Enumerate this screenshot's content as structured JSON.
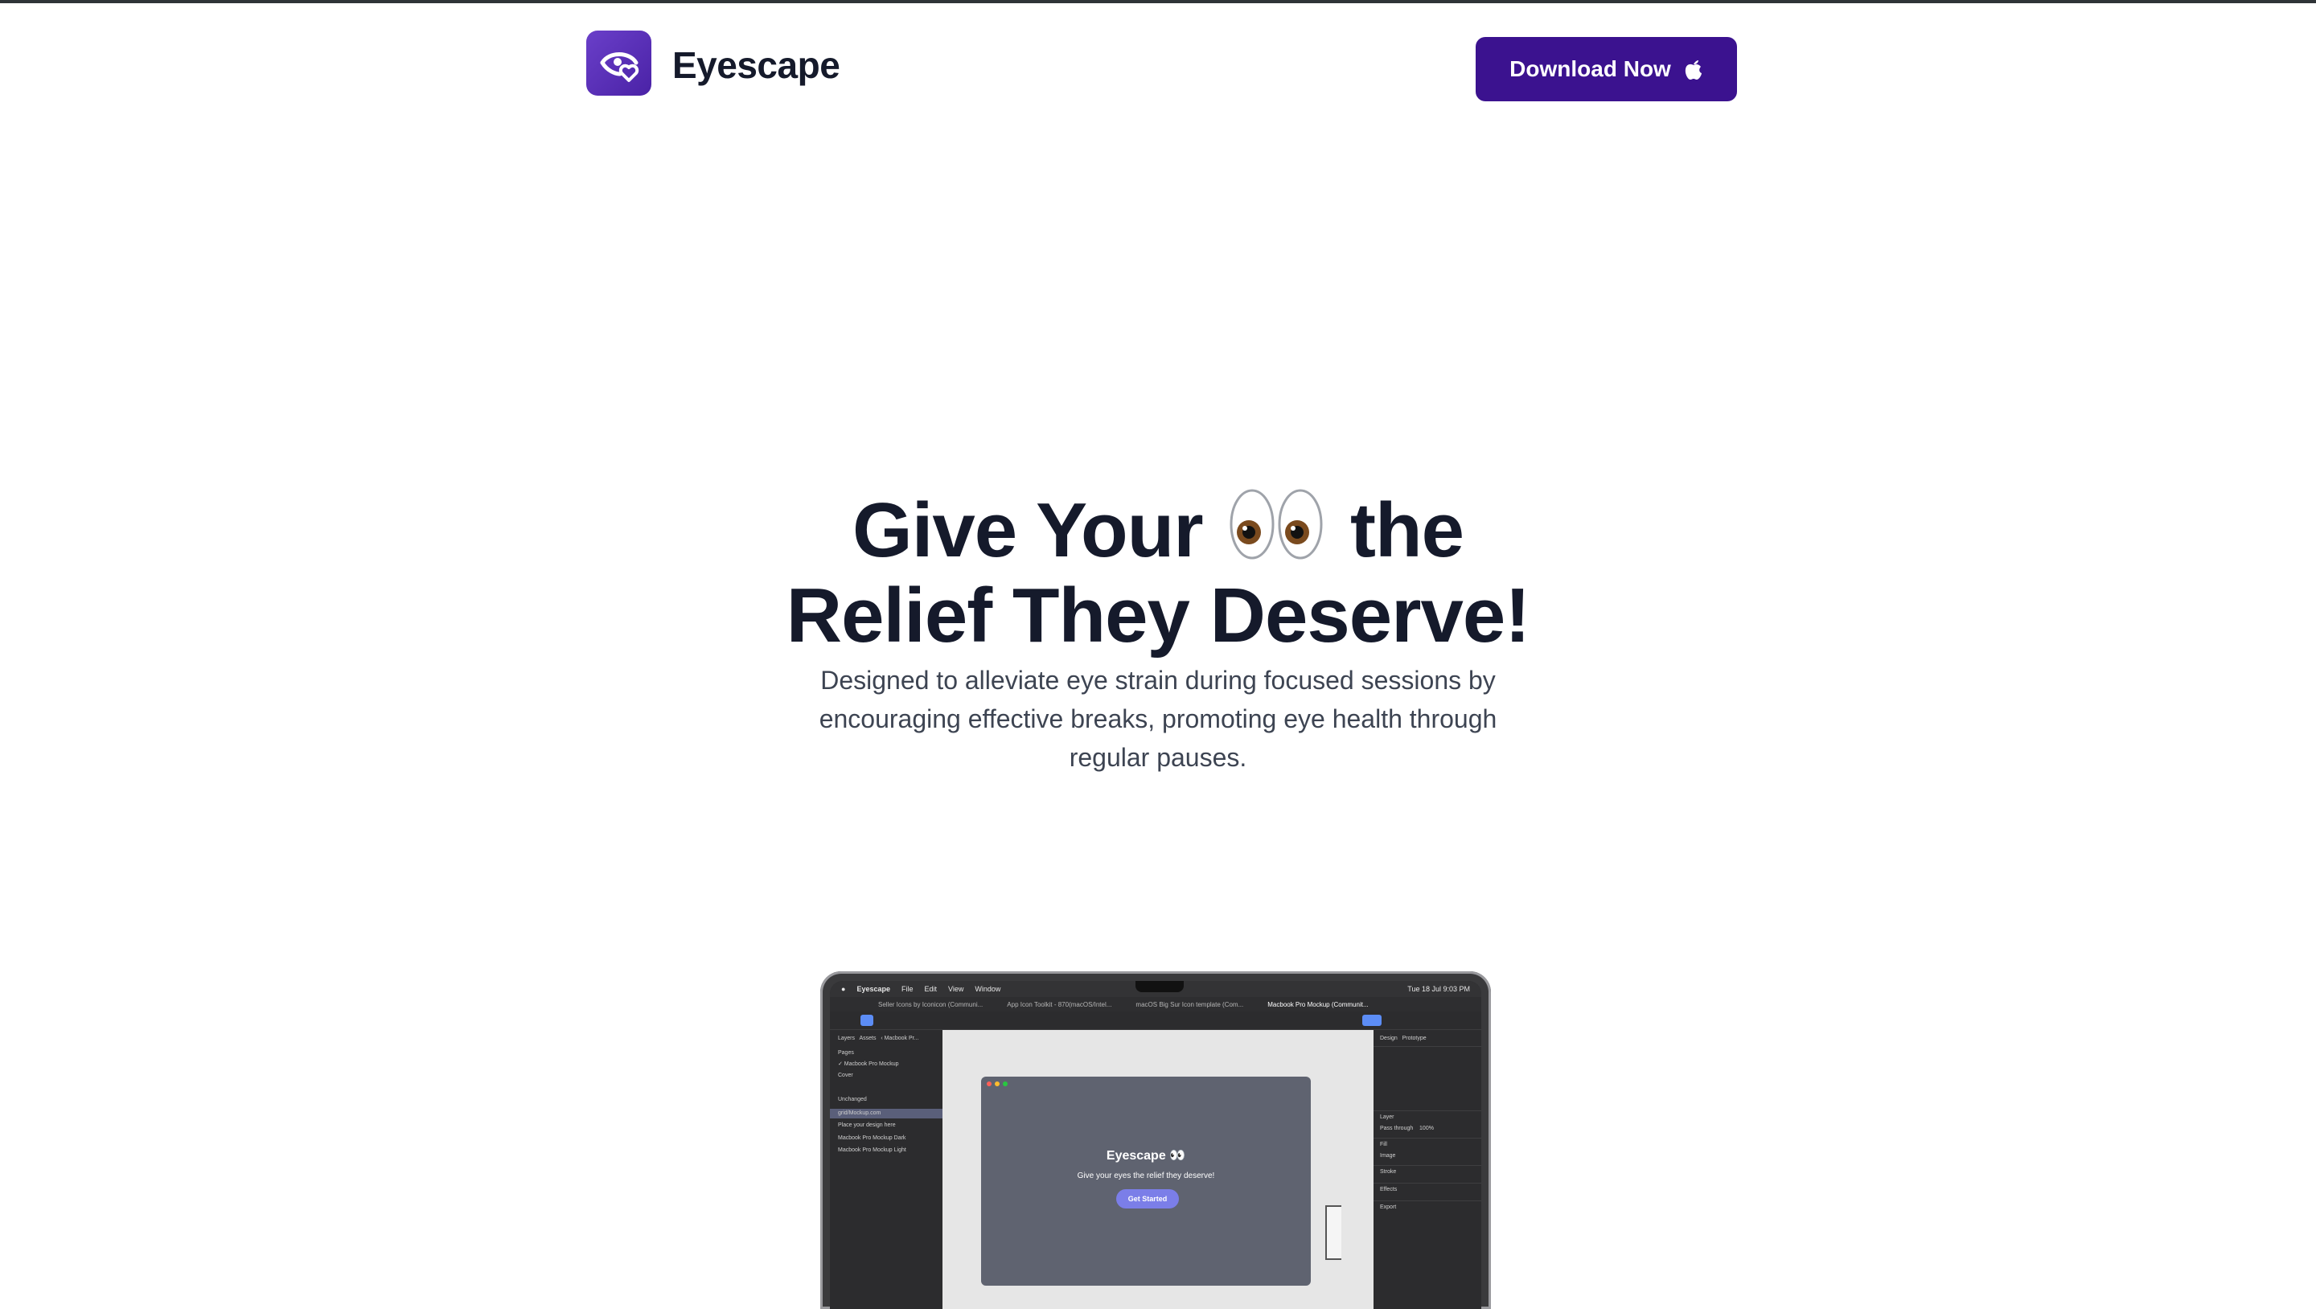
{
  "header": {
    "brand": "Eyescape",
    "download_label": "Download Now",
    "download_icon": "apple-icon",
    "logo_icon": "eye-heart-icon"
  },
  "hero": {
    "title_part1": "Give Your",
    "title_emoji": "eyes-emoji",
    "title_part2": "the",
    "title_line2": "Relief They Deserve!",
    "subtitle": "Designed to alleviate eye strain during focused sessions by encouraging effective breaks, promoting eye health through regular pauses."
  },
  "mockup": {
    "menubar": {
      "app": "Eyescape",
      "items": [
        "File",
        "Edit",
        "View",
        "Window"
      ],
      "clock": "Tue 18 Jul  9:03 PM"
    },
    "tabs": [
      "Seller Icons by Iconicon (Communi...",
      "App Icon Toolkit - 870(macOS/Intel...",
      "macOS Big Sur Icon template (Com...",
      "Macbook Pro Mockup (Communit..."
    ],
    "left_panel": {
      "tabs": [
        "Layers",
        "Assets",
        "‹ Macbook Pr..."
      ],
      "pages_label": "Pages",
      "rows": [
        "✓ Macbook Pro Mockup",
        "Cover",
        "Unchanged",
        "grid/Mockup.com",
        "Place your design here",
        "Macbook Pro Mockup Dark",
        "Macbook Pro Mockup Light"
      ]
    },
    "right_panel": {
      "tabs": [
        "Design",
        "Prototype"
      ],
      "sections": [
        "Layer",
        "Fill",
        "Stroke",
        "Effects",
        "Export"
      ],
      "pass_through": "Pass through",
      "opacity": "100%",
      "image_label": "Image"
    },
    "app_window": {
      "title": "Eyescape 👀",
      "subtitle": "Give your eyes the relief they deserve!",
      "button": "Get Started"
    }
  },
  "colors": {
    "brand": "#3b128f",
    "text_dark": "#151a2b",
    "text_muted": "#3d4452",
    "accent_button": "#7b7ee8"
  }
}
